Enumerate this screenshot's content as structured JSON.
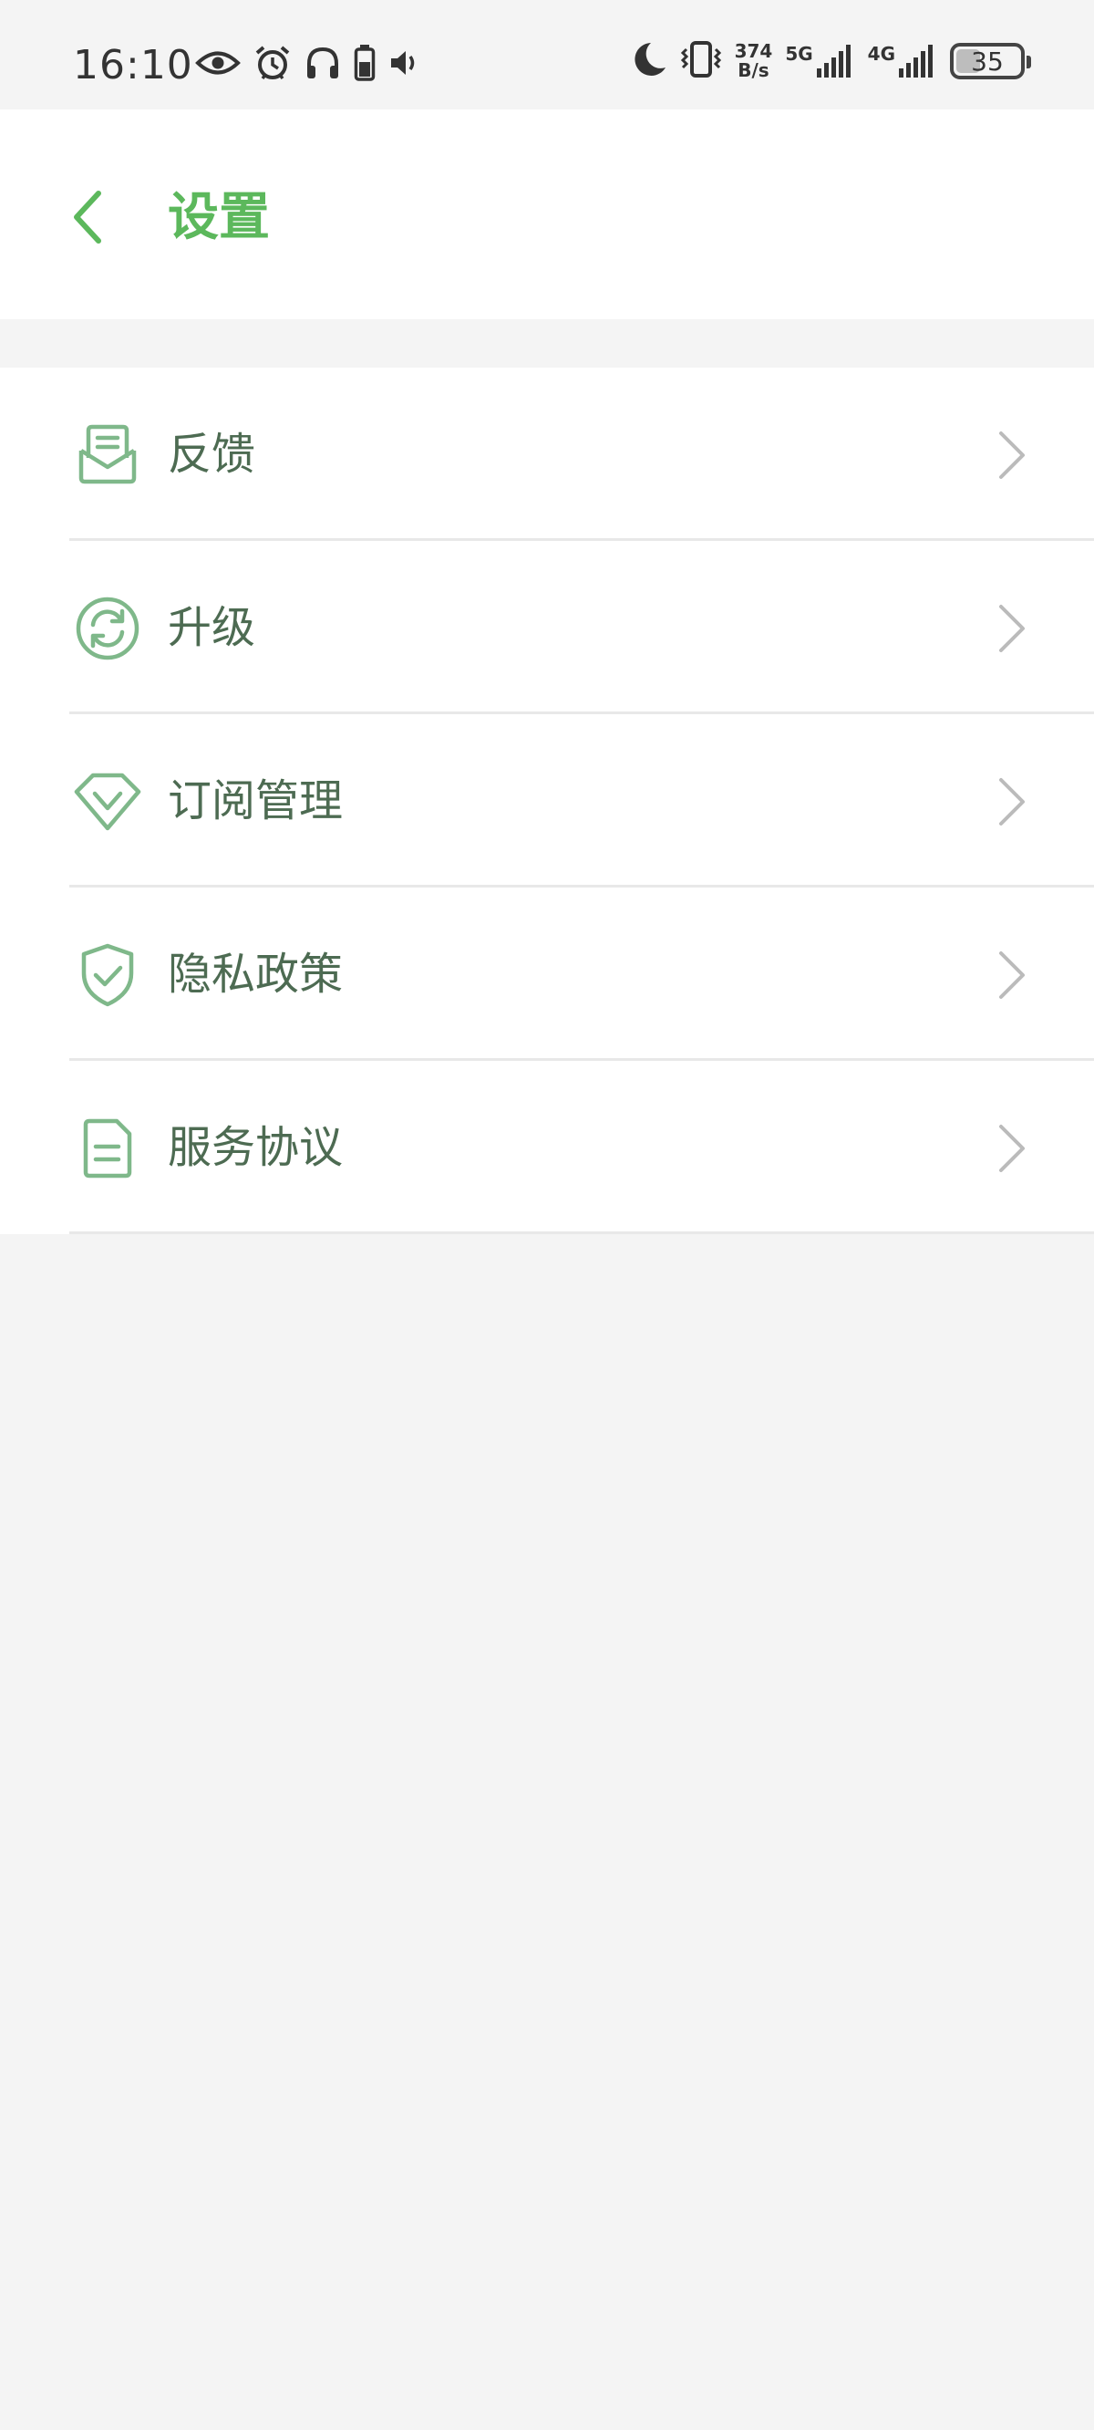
{
  "status_bar": {
    "time": "16:10",
    "speed_value": "374",
    "speed_unit": "B/s",
    "net_5g": "5G",
    "net_4g": "4G",
    "battery": "35",
    "left_icons": [
      "eye-icon",
      "alarm-icon",
      "headphones-icon",
      "battery-saver-icon",
      "volume-icon"
    ],
    "right_icons": [
      "moon-icon",
      "vibrate-icon",
      "signal-5g-icon",
      "signal-4g-icon",
      "battery-icon"
    ]
  },
  "header": {
    "title": "设置",
    "back_icon": "chevron-left-icon"
  },
  "colors": {
    "accent": "#5cb85c",
    "icon": "#7fb88a",
    "label": "#4d6b52",
    "chevron": "#bbbbbb",
    "background": "#f4f4f4"
  },
  "settings": {
    "items": [
      {
        "label": "反馈",
        "icon": "feedback-mail-icon"
      },
      {
        "label": "升级",
        "icon": "upgrade-refresh-icon"
      },
      {
        "label": "订阅管理",
        "icon": "diamond-icon"
      },
      {
        "label": "隐私政策",
        "icon": "shield-check-icon"
      },
      {
        "label": "服务协议",
        "icon": "document-icon"
      }
    ]
  }
}
